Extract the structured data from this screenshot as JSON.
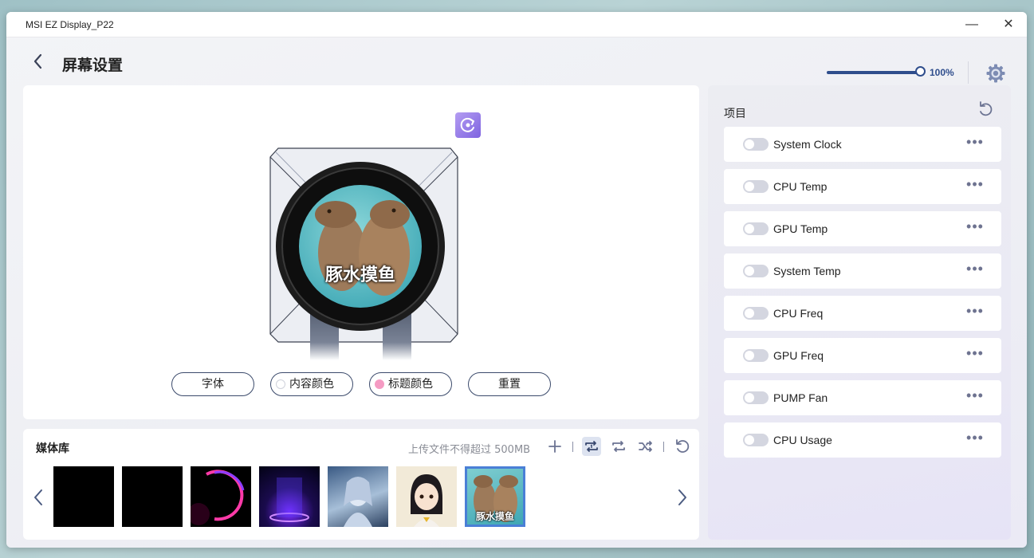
{
  "window": {
    "title": "MSI EZ Display_P22",
    "minimize_glyph": "—",
    "close_glyph": "✕"
  },
  "header": {
    "page_title": "屏幕设置",
    "zoom_value": 1.0,
    "zoom_label": "100%"
  },
  "preview": {
    "overlay_caption": "豚水摸鱼",
    "buttons": [
      {
        "label": "字体",
        "dot_color": null
      },
      {
        "label": "内容颜色",
        "dot_color": "#ffffff"
      },
      {
        "label": "标题颜色",
        "dot_color": "#f59bc3"
      },
      {
        "label": "重置",
        "dot_color": null
      }
    ]
  },
  "media": {
    "title": "媒体库",
    "hint": "上传文件不得超过 500MB",
    "tools": [
      "add-icon",
      "repeat-one-icon",
      "repeat-icon",
      "shuffle-icon",
      "refresh-icon"
    ],
    "thumbnails": [
      {
        "kind": "black",
        "label": ""
      },
      {
        "kind": "black",
        "label": ""
      },
      {
        "kind": "neon-ring",
        "label": ""
      },
      {
        "kind": "portal",
        "label": ""
      },
      {
        "kind": "anime-girl-silver",
        "label": ""
      },
      {
        "kind": "anime-girl-dark",
        "label": ""
      },
      {
        "kind": "capybara",
        "label": "豚水摸鱼",
        "selected": true
      }
    ]
  },
  "panel": {
    "title": "项目",
    "items": [
      {
        "label": "System Clock",
        "enabled": false
      },
      {
        "label": "CPU Temp",
        "enabled": false
      },
      {
        "label": "GPU Temp",
        "enabled": false
      },
      {
        "label": "System Temp",
        "enabled": false
      },
      {
        "label": "CPU Freq",
        "enabled": false
      },
      {
        "label": "GPU Freq",
        "enabled": false
      },
      {
        "label": "PUMP Fan",
        "enabled": false
      },
      {
        "label": "CPU Usage",
        "enabled": false
      }
    ],
    "more_glyph": "•••"
  },
  "colors": {
    "accent": "#2e4d8c",
    "rotate_button": "#8b73e6",
    "selected_border": "#4a7fd6"
  }
}
